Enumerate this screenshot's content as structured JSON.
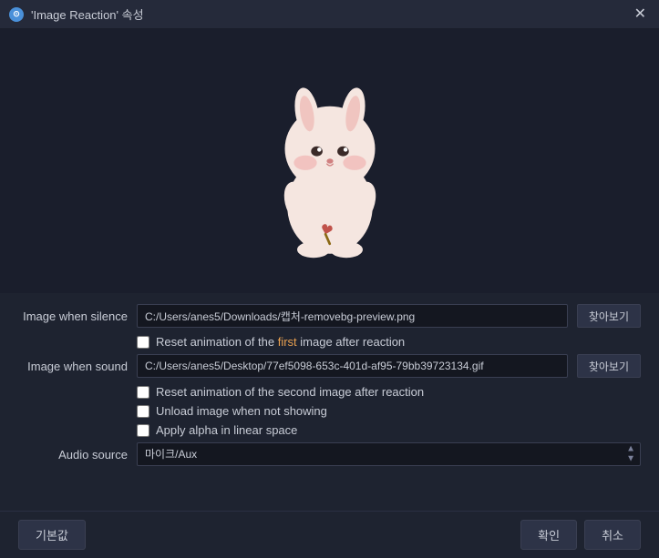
{
  "titleBar": {
    "title": "'Image Reaction' 속성",
    "closeLabel": "✕"
  },
  "form": {
    "imageSilenceLabel": "Image when silence",
    "imageSilencePath": "C:/Users/anes5/Downloads/캡처-removebg-preview.png",
    "imageSilenceBrowse": "찾아보기",
    "resetFirstLabel": "Reset animation of the ",
    "resetFirstHighlight": "first",
    "resetFirstSuffix": " image after reaction",
    "imageSoundLabel": "Image when sound",
    "imageSoundPath": "C:/Users/anes5/Desktop/77ef5098-653c-401d-af95-79bb39723134.gif",
    "imageSoundBrowse": "찾아보기",
    "resetSecondLabel": "Reset animation of the second image after reaction",
    "unloadLabel": "Unload image when not showing",
    "applyAlphaLabel": "Apply alpha in linear space",
    "audioSourceLabel": "Audio source",
    "audioSourceValue": "마이크/Aux"
  },
  "footer": {
    "resetBtn": "기본값",
    "confirmBtn": "확인",
    "cancelBtn": "취소"
  }
}
